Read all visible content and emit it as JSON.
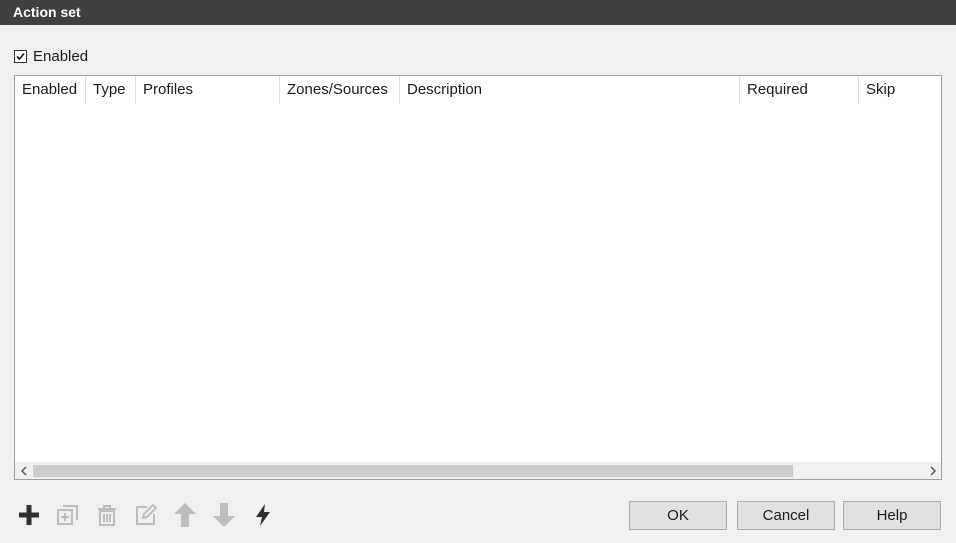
{
  "window": {
    "title": "Action set"
  },
  "enabled": {
    "label": "Enabled",
    "checked": true
  },
  "table": {
    "columns": [
      "Enabled",
      "Type",
      "Profiles",
      "Zones/Sources",
      "Description",
      "Required",
      "Skip"
    ],
    "rows": []
  },
  "toolbar": {
    "icons": [
      "add-icon",
      "duplicate-icon",
      "delete-icon",
      "edit-icon",
      "move-up-icon",
      "move-down-icon",
      "run-icon"
    ]
  },
  "buttons": {
    "ok": "OK",
    "cancel": "Cancel",
    "help": "Help"
  }
}
